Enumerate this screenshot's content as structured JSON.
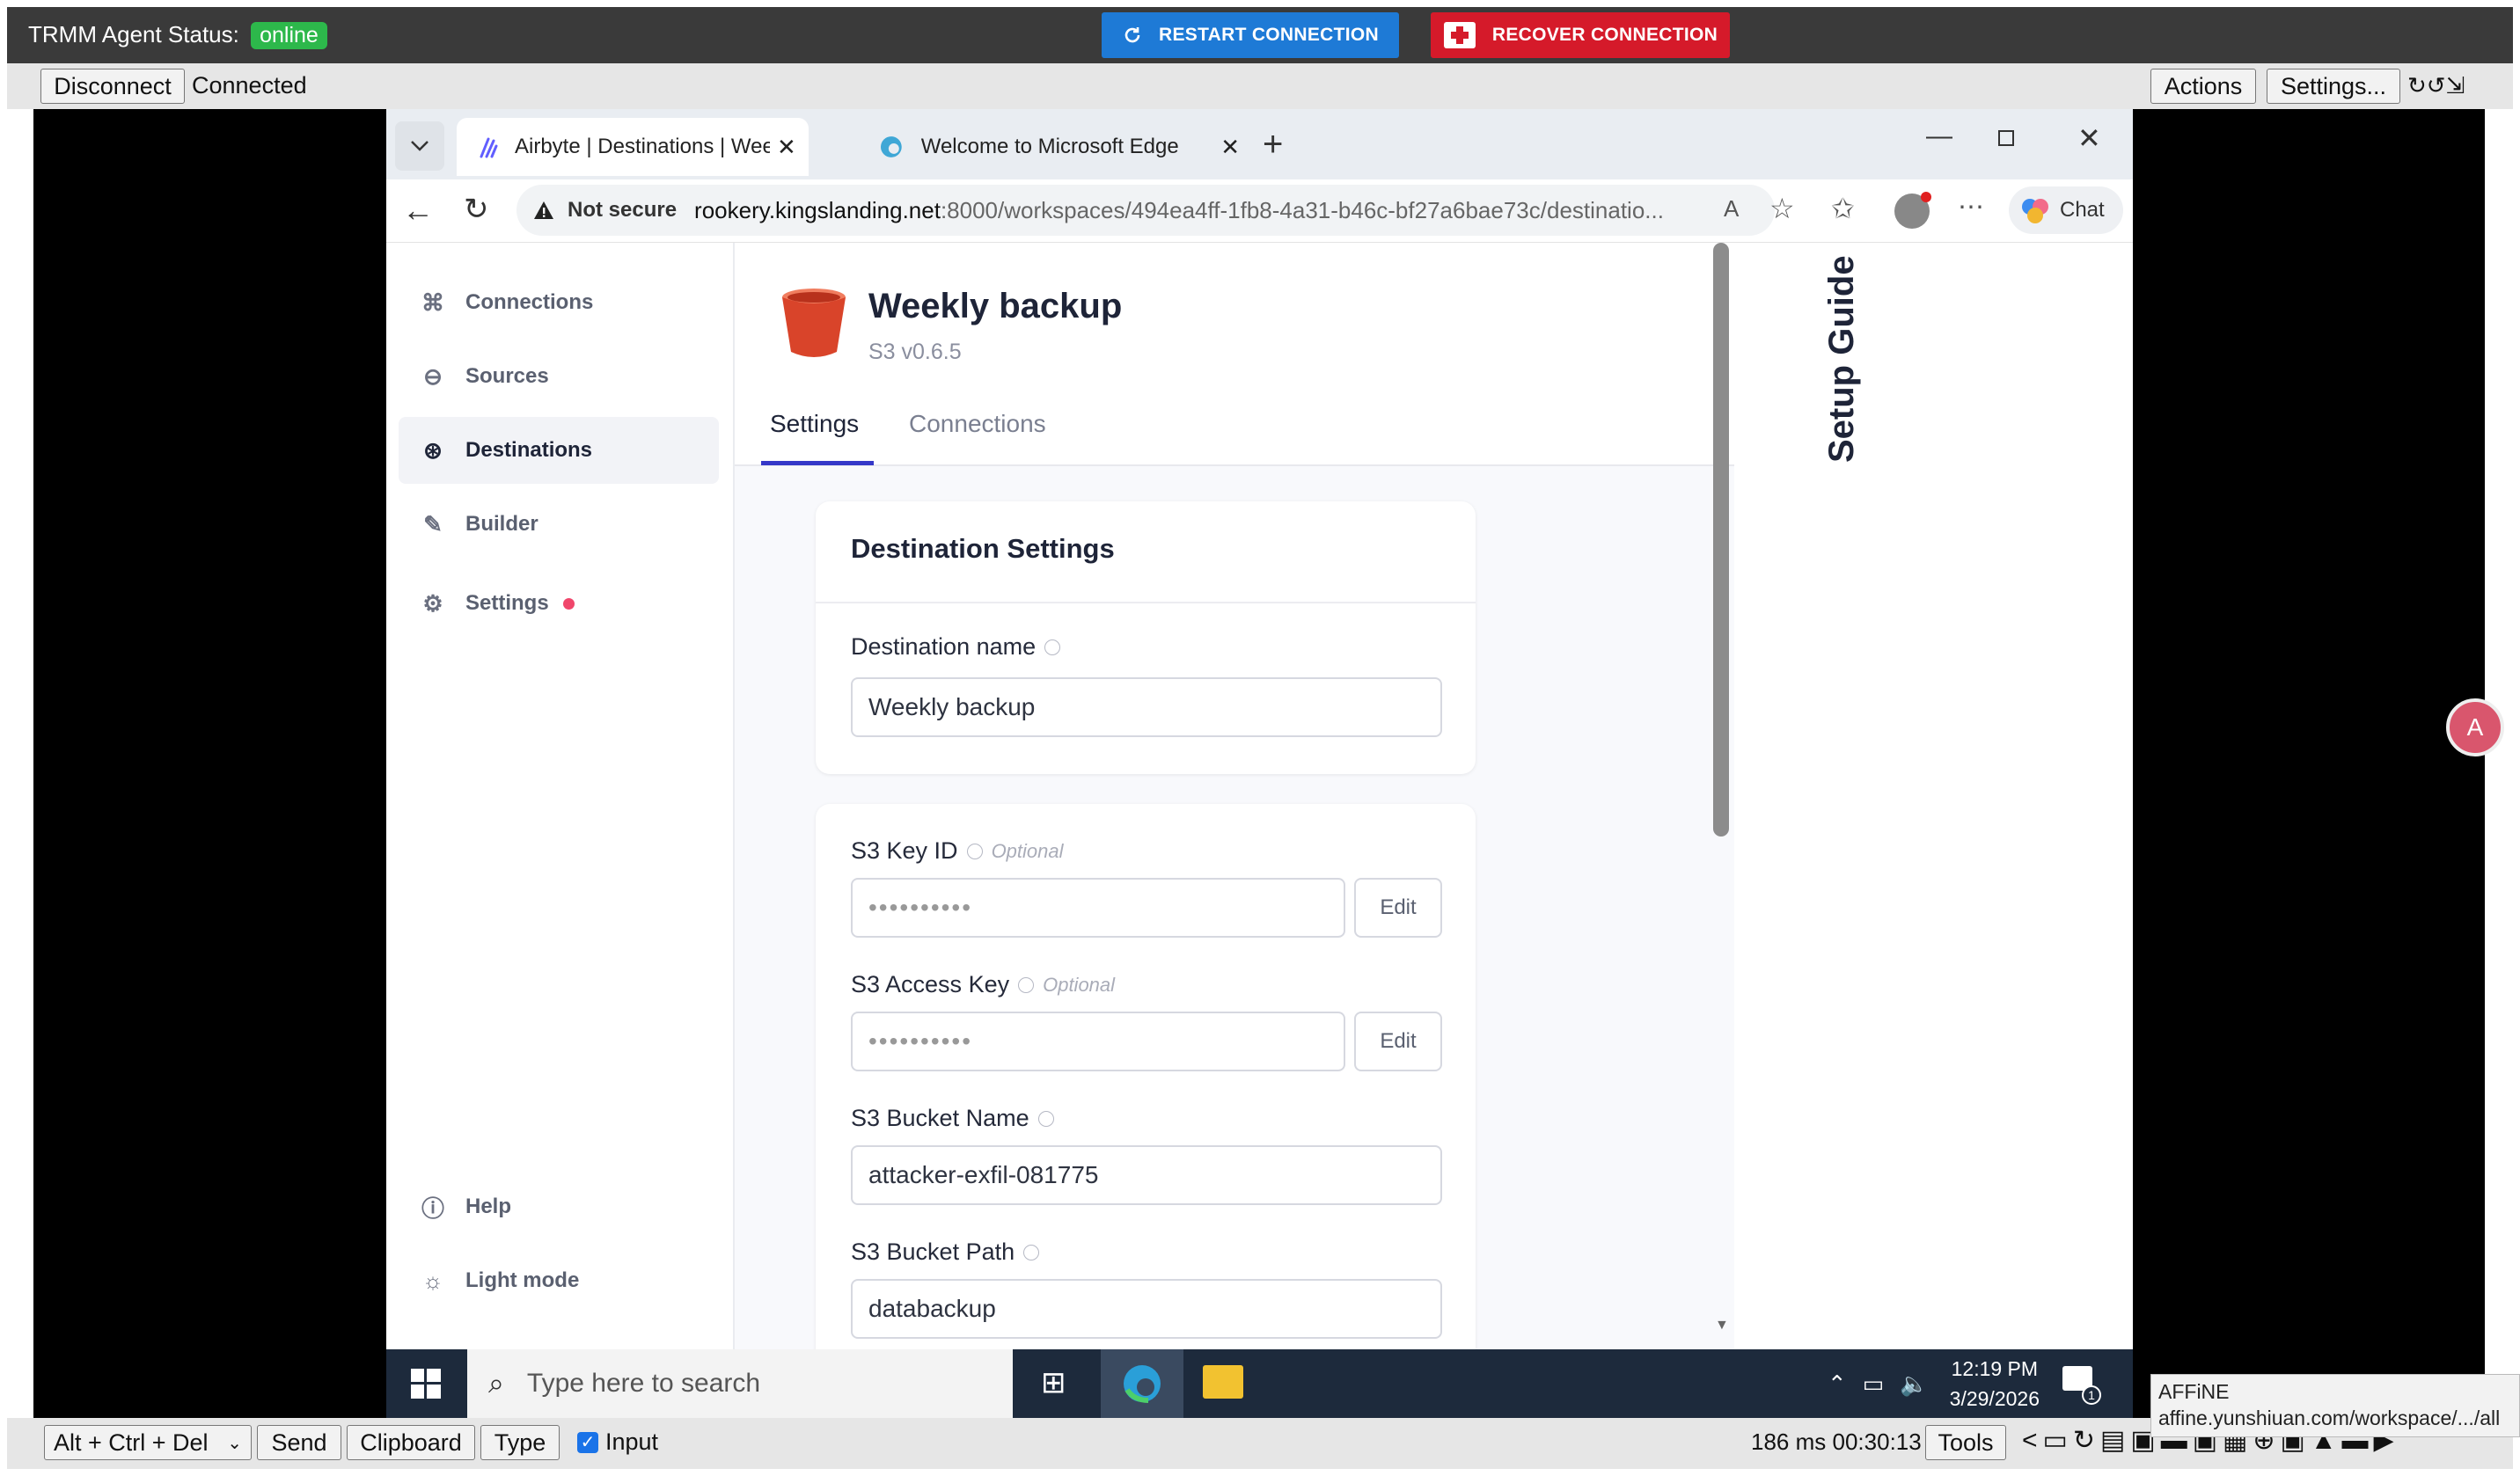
{
  "top_bar": {
    "status_label": "TRMM Agent Status:",
    "status_value": "online",
    "restart_label": "RESTART CONNECTION",
    "recover_label": "RECOVER CONNECTION",
    "colors": {
      "online": "#2db84b",
      "restart": "#1e7ad6",
      "recover": "#d51a2a"
    }
  },
  "control_bar": {
    "disconnect_label": "Disconnect",
    "connection_status": "Connected",
    "actions_label": "Actions",
    "settings_label": "Settings...",
    "extra_icons": "↻↺⇲"
  },
  "browser": {
    "tabs": [
      {
        "title": "Airbyte | Destinations | Weekly bac",
        "active": true
      },
      {
        "title": "Welcome to Microsoft Edge",
        "active": false
      }
    ],
    "not_secure_label": "Not secure",
    "url_host": "rookery.kingslanding.net",
    "url_rest": ":8000/workspaces/494ea4ff-1fb8-4a31-b46c-bf27a6bae73c/destinatio...",
    "chat_label": "Chat"
  },
  "airbyte": {
    "nav": [
      {
        "label": "Connections",
        "icon": "connections-icon"
      },
      {
        "label": "Sources",
        "icon": "sources-icon"
      },
      {
        "label": "Destinations",
        "icon": "destinations-icon",
        "active": true
      },
      {
        "label": "Builder",
        "icon": "builder-icon"
      },
      {
        "label": "Settings",
        "icon": "settings-icon",
        "badge": true
      }
    ],
    "nav_bottom": [
      {
        "label": "Help",
        "icon": "help-icon"
      },
      {
        "label": "Light mode",
        "icon": "sun-icon"
      }
    ],
    "destination_title": "Weekly backup",
    "destination_version": "S3 v0.6.5",
    "tabs": [
      "Settings",
      "Connections"
    ],
    "card_title": "Destination Settings",
    "fields": {
      "destination_name": {
        "label": "Destination name",
        "value": "Weekly backup"
      },
      "s3_key_id": {
        "label": "S3 Key ID",
        "hint": "Optional",
        "value": "••••••••••",
        "edit": "Edit"
      },
      "s3_access_key": {
        "label": "S3 Access Key",
        "hint": "Optional",
        "value": "••••••••••",
        "edit": "Edit"
      },
      "s3_bucket_name": {
        "label": "S3 Bucket Name",
        "value": "attacker-exfil-081775"
      },
      "s3_bucket_path": {
        "label": "S3 Bucket Path",
        "value": "databackup"
      }
    },
    "setup_guide_label": "Setup Guide"
  },
  "taskbar": {
    "search_placeholder": "Type here to search",
    "time": "12:19 PM",
    "date": "3/29/2026",
    "notification_count": "1"
  },
  "status_bar": {
    "keys_select": "Alt + Ctrl + Del",
    "send_label": "Send",
    "clipboard_label": "Clipboard",
    "type_label": "Type",
    "input_label": "Input",
    "latency": "186 ms",
    "elapsed": "00:30:13",
    "tools_label": "Tools"
  },
  "popup": {
    "title": "AFFiNE",
    "url": "affine.yunshiuan.com/workspace/.../all"
  }
}
